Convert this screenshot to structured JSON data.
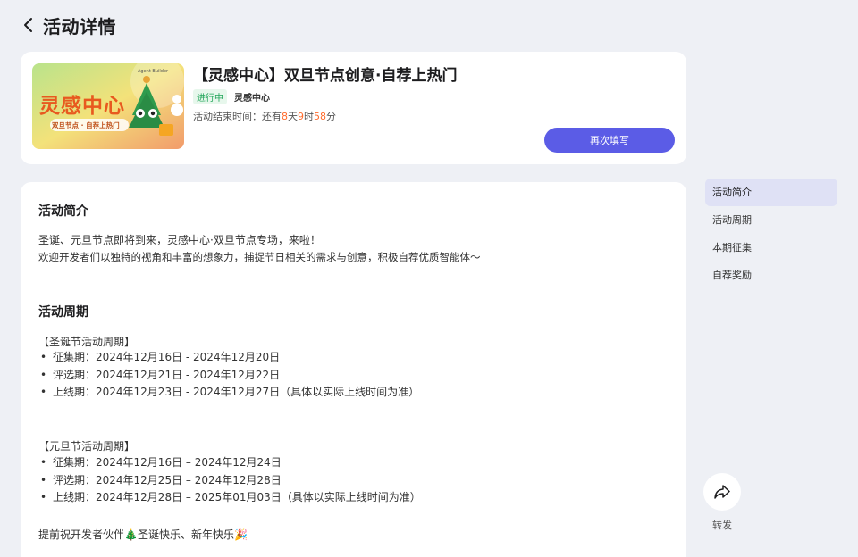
{
  "header": {
    "title": "活动详情",
    "back_icon": "chevron-left-icon"
  },
  "activity": {
    "title": "【灵感中心】双旦节点创意·自荐上热门",
    "status": "进行中",
    "organizer": "灵感中心",
    "countdown_label": "活动结束时间：还有",
    "days": "8",
    "days_unit": "天",
    "hours": "9",
    "hours_unit": "时",
    "minutes": "58",
    "minutes_unit": "分",
    "refill_button": "再次填写",
    "banner": {
      "title": "灵感中心",
      "subtitle": "双旦节点 · 自荐上热门",
      "brand": "Agent Builder"
    }
  },
  "intro": {
    "title": "活动简介",
    "line1": "圣诞、元旦节点即将到来，灵感中心·双旦节点专场，来啦！",
    "line2": "欢迎开发者们以独特的视角和丰富的想象力，捕捉节日相关的需求与创意，积极自荐优质智能体～"
  },
  "period": {
    "title": "活动周期",
    "christmas": {
      "heading": "【圣诞节活动周期】",
      "items": [
        "征集期：2024年12月16日 - 2024年12月20日",
        "评选期：2024年12月21日 - 2024年12月22日",
        "上线期：2024年12月23日 - 2024年12月27日（具体以实际上线时间为准）"
      ]
    },
    "newyear": {
      "heading": "【元旦节活动周期】",
      "items": [
        "征集期：2024年12月16日 – 2024年12月24日",
        "评选期：2024年12月25日 – 2024年12月28日",
        "上线期：2024年12月28日 – 2025年01月03日（具体以实际上线时间为准）"
      ]
    },
    "greeting": "提前祝开发者伙伴🎄圣诞快乐、新年快乐🎉"
  },
  "side_nav": {
    "items": [
      "活动简介",
      "活动周期",
      "本期征集",
      "自荐奖励"
    ],
    "active_index": 0
  },
  "share": {
    "label": "转发",
    "icon": "share-icon"
  },
  "colors": {
    "accent": "#5b5ce6",
    "status_green": "#22a55a",
    "countdown_orange": "#ff6b2c"
  }
}
